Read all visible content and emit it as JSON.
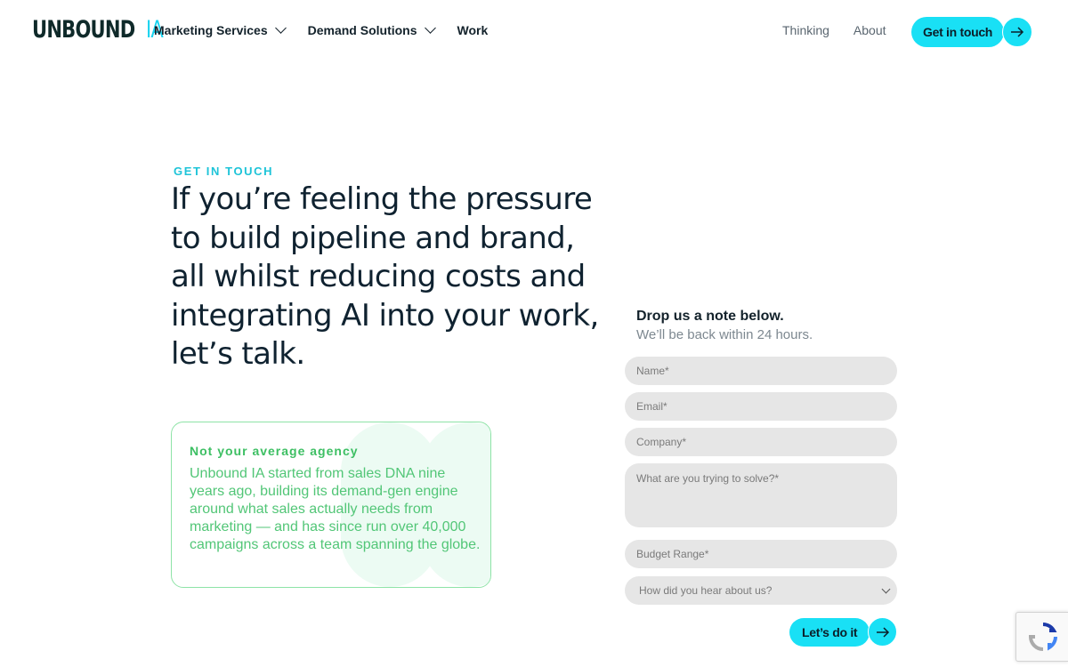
{
  "header": {
    "logo_main": "UNBOUND",
    "logo_accent": "IA",
    "nav": [
      {
        "label": "Marketing Services",
        "has_dropdown": true
      },
      {
        "label": "Demand Solutions",
        "has_dropdown": true
      },
      {
        "label": "Work",
        "has_dropdown": false
      }
    ],
    "nav_right": [
      {
        "label": "Thinking"
      },
      {
        "label": "About"
      }
    ],
    "cta_label": "Get in touch"
  },
  "hero": {
    "eyebrow": "GET IN TOUCH",
    "headline": "If you’re feeling the pressure to build pipeline and brand, all whilst reducing costs and integrating AI into your work, let’s talk."
  },
  "card": {
    "title": "Not your average agency",
    "body": "Unbound IA started from sales DNA nine years ago, building its demand-gen engine around what sales actually needs from marketing — and has since run over 40,000 campaigns across a team spanning the globe."
  },
  "form": {
    "title": "Drop us a note below.",
    "subtitle": "We’ll be back within 24 hours.",
    "fields": {
      "name": "Name*",
      "email": "Email*",
      "company": "Company*",
      "problem": "What are you trying to solve?*",
      "budget": "Budget Range*"
    },
    "source_select": "How did you hear about us?",
    "submit_label": "Let’s do it"
  },
  "colors": {
    "accent": "#19e0f5",
    "eyebrow": "#1ec4d8",
    "card_green": "#52c677",
    "field_bg": "#e6e6e6"
  },
  "icons": {
    "cta_arrow": "arrow-right-icon",
    "dropdown": "chevron-down-icon",
    "recaptcha": "recaptcha-icon"
  }
}
